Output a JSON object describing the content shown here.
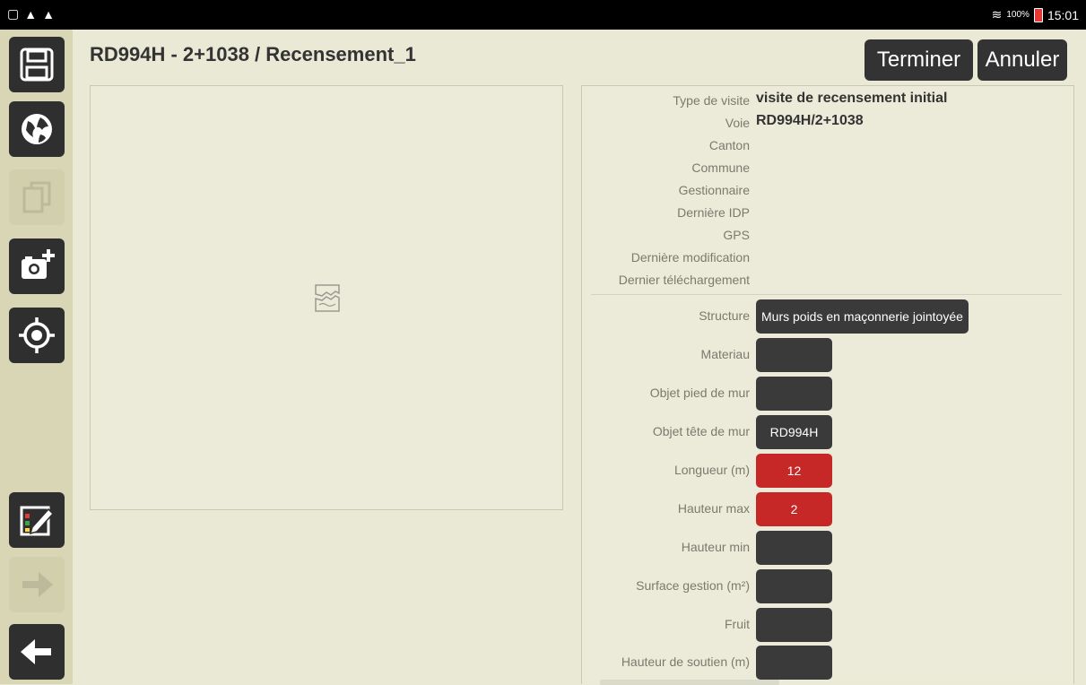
{
  "status_bar": {
    "battery": "100%",
    "time": "15:01"
  },
  "header": {
    "title": "RD994H - 2+1038 / Recensement_1",
    "finish_label": "Terminer",
    "cancel_label": "Annuler"
  },
  "sidebar": {
    "buttons": [
      {
        "icon": "save-icon",
        "enabled": true
      },
      {
        "icon": "globe-icon",
        "enabled": true
      },
      {
        "icon": "copy-icon",
        "enabled": false
      },
      {
        "icon": "camera-add-icon",
        "enabled": true
      },
      {
        "icon": "target-icon",
        "enabled": true
      },
      {
        "icon": "checklist-edit-icon",
        "enabled": true
      },
      {
        "icon": "arrow-right-icon",
        "enabled": false
      },
      {
        "icon": "arrow-left-icon",
        "enabled": true
      }
    ]
  },
  "info": {
    "rows": [
      {
        "label": "Type de visite",
        "value": "visite de recensement initial"
      },
      {
        "label": "Voie",
        "value": "RD994H/2+1038"
      },
      {
        "label": "Canton",
        "value": ""
      },
      {
        "label": "Commune",
        "value": ""
      },
      {
        "label": "Gestionnaire",
        "value": ""
      },
      {
        "label": "Dernière IDP",
        "value": ""
      },
      {
        "label": "GPS",
        "value": ""
      },
      {
        "label": "Dernière modification",
        "value": ""
      },
      {
        "label": "Dernier téléchargement",
        "value": ""
      }
    ]
  },
  "fields": [
    {
      "label": "Structure",
      "value": "Murs poids en maçonnerie jointoyée",
      "required": false
    },
    {
      "label": "Materiau",
      "value": "",
      "required": false
    },
    {
      "label": "Objet pied de mur",
      "value": "",
      "required": false
    },
    {
      "label": "Objet tête de mur",
      "value": "RD994H",
      "required": false
    },
    {
      "label": "Longueur (m)",
      "value": "12",
      "required": true
    },
    {
      "label": "Hauteur max",
      "value": "2",
      "required": true
    },
    {
      "label": "Hauteur min",
      "value": "",
      "required": false
    },
    {
      "label": "Surface gestion (m²)",
      "value": "",
      "required": false
    },
    {
      "label": "Fruit",
      "value": "",
      "required": false
    },
    {
      "label": "Hauteur de soutien (m)",
      "value": "",
      "required": false
    }
  ],
  "colors": {
    "accent_dark": "#333333",
    "required_red": "#c62828",
    "background": "#e9e9d6"
  }
}
